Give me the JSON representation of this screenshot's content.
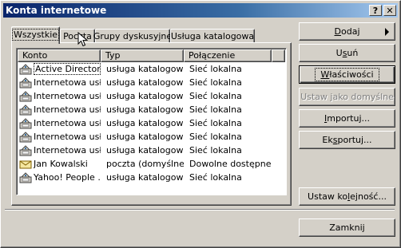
{
  "window": {
    "title": "Konta internetowe",
    "help_glyph": "?",
    "close_glyph": "✕"
  },
  "tabs": [
    {
      "label": "Wszystkie"
    },
    {
      "label": "Poczta"
    },
    {
      "label": "Grupy dyskusyjne"
    },
    {
      "label": "Usługa katalogowa"
    }
  ],
  "list": {
    "columns": [
      "Konto",
      "Typ",
      "Połączenie"
    ],
    "rows": [
      {
        "name": "Active Directory",
        "type": "usługa katalogowa",
        "connection": "Sieć lokalna",
        "icon": "directory-service-icon"
      },
      {
        "name": "Internetowa usł...",
        "type": "usługa katalogowa",
        "connection": "Sieć lokalna",
        "icon": "directory-service-icon"
      },
      {
        "name": "Internetowa usł...",
        "type": "usługa katalogowa",
        "connection": "Sieć lokalna",
        "icon": "directory-service-icon"
      },
      {
        "name": "Internetowa usł...",
        "type": "usługa katalogowa",
        "connection": "Sieć lokalna",
        "icon": "directory-service-icon"
      },
      {
        "name": "Internetowa usł...",
        "type": "usługa katalogowa",
        "connection": "Sieć lokalna",
        "icon": "directory-service-icon"
      },
      {
        "name": "Internetowa usł...",
        "type": "usługa katalogowa",
        "connection": "Sieć lokalna",
        "icon": "directory-service-icon"
      },
      {
        "name": "Internetowa usł...",
        "type": "usługa katalogowa",
        "connection": "Sieć lokalna",
        "icon": "directory-service-icon"
      },
      {
        "name": "Jan Kowalski",
        "type": "poczta (domyślne)",
        "connection": "Dowolne dostępne",
        "icon": "mail-account-icon"
      },
      {
        "name": "Yahoo! People ...",
        "type": "usługa katalogowa",
        "connection": "Sieć lokalna",
        "icon": "directory-service-icon"
      }
    ]
  },
  "buttons": {
    "add": "Dodaj",
    "remove": "Usuń",
    "properties": "Właściwości",
    "set_default": "Ustaw jako domyślne",
    "import": "Importuj...",
    "export": "Eksportuj...",
    "set_order": "Ustaw kolejność...",
    "close": "Zamknij"
  },
  "colors": {
    "titlebar_start": "#0a246a",
    "titlebar_end": "#a6caf0",
    "face": "#d4d0c8"
  }
}
